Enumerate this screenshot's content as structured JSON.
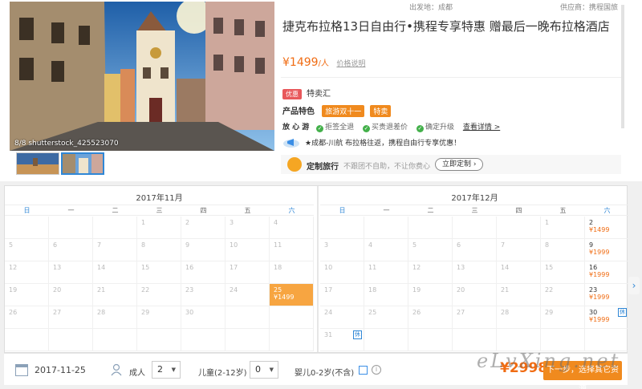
{
  "gallery": {
    "caption": "8/8 shutterstock_425523070"
  },
  "product": {
    "departure": "出发地：成都",
    "supplier": "供应商：携程国旅",
    "title": "捷克布拉格13日自由行•携程专享特惠 赠最后一晚布拉格酒店",
    "price": "¥1499",
    "price_unit": "/人",
    "price_note": "价格说明",
    "deal_tag": "优惠",
    "deal_text": "特卖汇",
    "features_label": "产品特色",
    "feature_tags": [
      "旅游双十一",
      "特卖"
    ],
    "zx_label": "放 心 游",
    "zx_items": [
      "拒签全退",
      "买贵退差价",
      "确定升级"
    ],
    "zx_more": "查看详情 >",
    "promo": "★成都-川航 布拉格往返，携程自由行专享优惠！",
    "custom_title": "定制旅行",
    "custom_desc": "不跟团不自助，不让你费心",
    "custom_btn": "立即定制 ›"
  },
  "calendar": {
    "weekdays": [
      "日",
      "一",
      "二",
      "三",
      "四",
      "五",
      "六"
    ],
    "months": [
      {
        "title": "2017年11月",
        "cells": [
          {
            "d": ""
          },
          {
            "d": ""
          },
          {
            "d": ""
          },
          {
            "d": "1"
          },
          {
            "d": "2"
          },
          {
            "d": "3"
          },
          {
            "d": "4"
          },
          {
            "d": "5"
          },
          {
            "d": "6"
          },
          {
            "d": "7"
          },
          {
            "d": "8"
          },
          {
            "d": "9"
          },
          {
            "d": "10"
          },
          {
            "d": "11"
          },
          {
            "d": "12"
          },
          {
            "d": "13"
          },
          {
            "d": "14"
          },
          {
            "d": "15"
          },
          {
            "d": "16"
          },
          {
            "d": "17"
          },
          {
            "d": "18"
          },
          {
            "d": "19"
          },
          {
            "d": "20"
          },
          {
            "d": "21"
          },
          {
            "d": "22"
          },
          {
            "d": "23"
          },
          {
            "d": "24"
          },
          {
            "d": "25",
            "p": "¥1499",
            "selected": true
          },
          {
            "d": "26"
          },
          {
            "d": "27"
          },
          {
            "d": "28"
          },
          {
            "d": "29"
          },
          {
            "d": "30"
          },
          {
            "d": ""
          },
          {
            "d": ""
          },
          {
            "d": ""
          },
          {
            "d": ""
          },
          {
            "d": ""
          },
          {
            "d": ""
          },
          {
            "d": ""
          },
          {
            "d": ""
          },
          {
            "d": ""
          }
        ]
      },
      {
        "title": "2017年12月",
        "cells": [
          {
            "d": ""
          },
          {
            "d": ""
          },
          {
            "d": ""
          },
          {
            "d": ""
          },
          {
            "d": ""
          },
          {
            "d": "1"
          },
          {
            "d": "2",
            "p": "¥1499"
          },
          {
            "d": "3"
          },
          {
            "d": "4"
          },
          {
            "d": "5"
          },
          {
            "d": "6"
          },
          {
            "d": "7"
          },
          {
            "d": "8"
          },
          {
            "d": "9",
            "p": "¥1999"
          },
          {
            "d": "10"
          },
          {
            "d": "11"
          },
          {
            "d": "12"
          },
          {
            "d": "13"
          },
          {
            "d": "14"
          },
          {
            "d": "15"
          },
          {
            "d": "16",
            "p": "¥1999"
          },
          {
            "d": "17"
          },
          {
            "d": "18"
          },
          {
            "d": "19"
          },
          {
            "d": "20"
          },
          {
            "d": "21"
          },
          {
            "d": "22"
          },
          {
            "d": "23",
            "p": "¥1999"
          },
          {
            "d": "24"
          },
          {
            "d": "25"
          },
          {
            "d": "26"
          },
          {
            "d": "27"
          },
          {
            "d": "28"
          },
          {
            "d": "29"
          },
          {
            "d": "30",
            "p": "¥1999",
            "h": "休"
          },
          {
            "d": "31",
            "h": "休"
          },
          {
            "d": ""
          },
          {
            "d": ""
          },
          {
            "d": ""
          },
          {
            "d": ""
          },
          {
            "d": ""
          },
          {
            "d": ""
          }
        ]
      }
    ]
  },
  "booking": {
    "date": "2017-11-25",
    "adult_label": "成人",
    "adult_value": "2",
    "child_label": "儿童(2-12岁)",
    "child_value": "0",
    "infant_label": "婴儿0-2岁(不含)",
    "info_mark": "i",
    "total": "¥2998",
    "book_btn": "下一步，选择其它资源"
  },
  "watermark": "eLvXing.net",
  "colors": {
    "accent_orange": "#f08a1e",
    "price_orange": "#f06c13",
    "weekend_blue": "#2f87d6",
    "selected_day": "#f7a541"
  }
}
